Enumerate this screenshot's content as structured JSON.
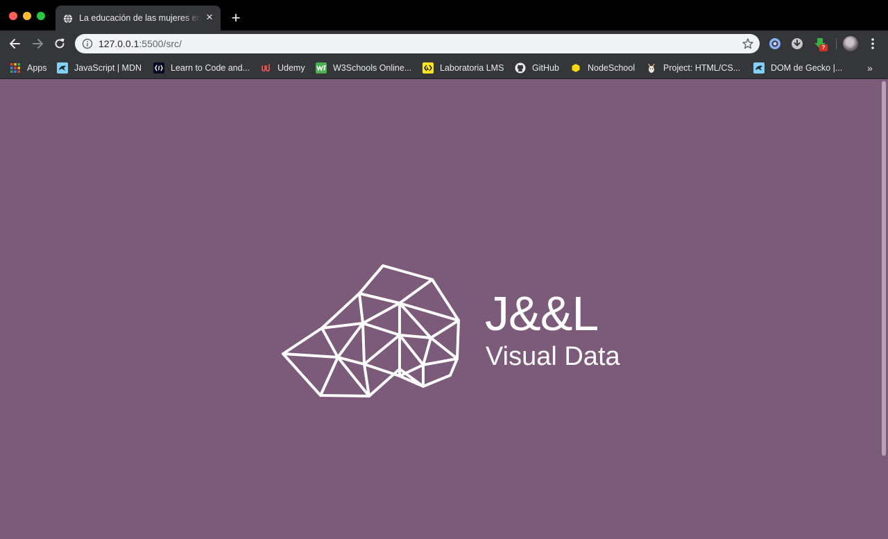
{
  "browser": {
    "tab": {
      "title": "La educación de las mujeres en",
      "close_icon": "×"
    },
    "new_tab_icon": "+",
    "address": {
      "host": "127.0.0.1",
      "path": ":5500/src/"
    },
    "extension_badge": "?",
    "bookmarks_overflow": "»",
    "bookmarks": [
      {
        "label": "Apps",
        "icon": "apps-grid-icon"
      },
      {
        "label": "JavaScript | MDN",
        "icon": "mdn-icon"
      },
      {
        "label": "Learn to Code and...",
        "icon": "freecodecamp-icon"
      },
      {
        "label": "Udemy",
        "icon": "udemy-icon"
      },
      {
        "label": "W3Schools Online...",
        "icon": "w3schools-icon"
      },
      {
        "label": "Laboratoria LMS",
        "icon": "laboratoria-icon"
      },
      {
        "label": "GitHub",
        "icon": "github-icon"
      },
      {
        "label": "NodeSchool",
        "icon": "nodeschool-icon"
      },
      {
        "label": "Project: HTML/CS...",
        "icon": "project-icon"
      },
      {
        "label": "DOM de Gecko |...",
        "icon": "mdn-icon"
      }
    ]
  },
  "page": {
    "background_color": "#7c5a7a",
    "brand": {
      "name": "J&&L",
      "tagline": "Visual Data"
    }
  }
}
